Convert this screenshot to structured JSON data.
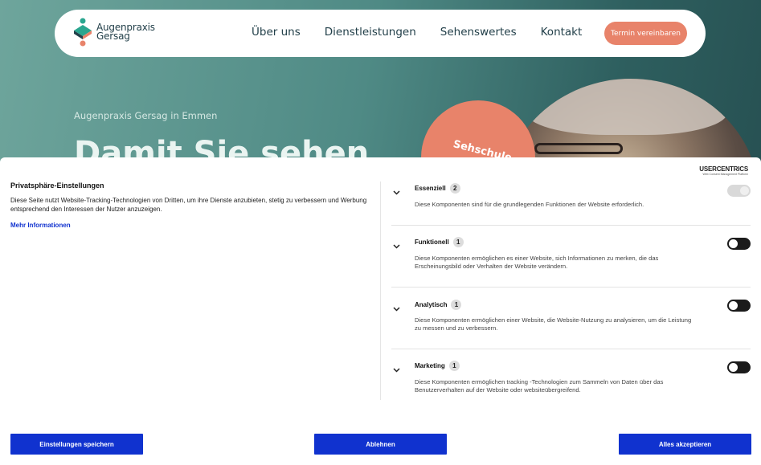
{
  "brand": {
    "name_line1": "Augenpraxis",
    "name_line2": "Gersag"
  },
  "nav": {
    "items": [
      {
        "label": "Über uns"
      },
      {
        "label": "Dienstleistungen"
      },
      {
        "label": "Sehenswertes"
      },
      {
        "label": "Kontakt"
      }
    ],
    "cta": "Termin vereinbaren"
  },
  "hero": {
    "subtitle": "Augenpraxis Gersag in Emmen",
    "title": "Damit Sie sehen",
    "badge": "Sehschule"
  },
  "consent": {
    "provider": "USERCENTRICS",
    "provider_tagline": "Web Consent Management Platform",
    "title": "Privatsphäre-Einstellungen",
    "description": "Diese Seite nutzt Website-Tracking-Technologien von Dritten, um ihre Dienste anzubieten, stetig zu verbessern und Werbung entsprechend den Interessen der Nutzer anzuzeigen.",
    "more_info": "Mehr Informationen",
    "categories": [
      {
        "name": "Essenziell",
        "count": "2",
        "description": "Diese Komponenten sind für die grundlegenden Funktionen der Website erforderlich.",
        "enabled": true,
        "locked": true
      },
      {
        "name": "Funktionell",
        "count": "1",
        "description": "Diese Komponenten ermöglichen es einer Website, sich Informationen zu merken, die das Erscheinungsbild oder Verhalten der Website verändern.",
        "enabled": false,
        "locked": false
      },
      {
        "name": "Analytisch",
        "count": "1",
        "description": "Diese Komponenten ermöglichen einer Website, die Website-Nutzung zu analysieren, um die Leistung zu messen und zu verbessern.",
        "enabled": false,
        "locked": false
      },
      {
        "name": "Marketing",
        "count": "1",
        "description": "Diese Komponenten ermöglichen tracking -Technologien zum Sammeln von Daten über das Benutzerverhalten auf der Website oder websiteübergreifend.",
        "enabled": false,
        "locked": false
      }
    ],
    "buttons": {
      "save": "Einstellungen speichern",
      "deny": "Ablehnen",
      "accept": "Alles akzeptieren"
    }
  },
  "colors": {
    "accent": "#1032cf",
    "brand_orange": "#e8836a",
    "hero_teal": "#4f8a85"
  },
  "icons": [
    "logo-mark-icon",
    "chevron-down-icon"
  ]
}
